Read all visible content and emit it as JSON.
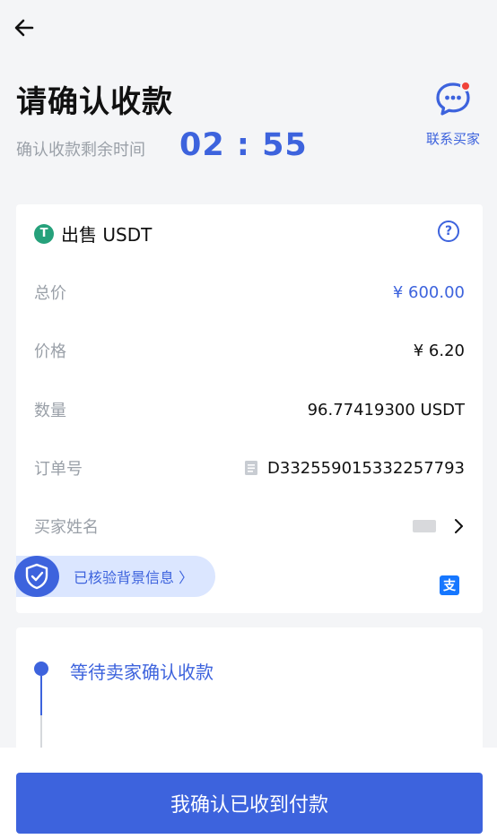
{
  "header": {
    "title": "请确认收款",
    "timer_label": "确认收款剩余时间",
    "timer": "02 : 55",
    "contact_label": "联系买家"
  },
  "order": {
    "title": "出售 USDT",
    "rows": [
      {
        "label": "总价",
        "value": "¥ 600.00"
      },
      {
        "label": "价格",
        "value": "¥ 6.20"
      },
      {
        "label": "数量",
        "value": "96.77419300 USDT"
      },
      {
        "label": "订单号",
        "value": "D332559015332257793"
      },
      {
        "label": "买家姓名",
        "value": ""
      }
    ],
    "verified_label": "已核验背景信息 〉",
    "alipay_glyph": "支"
  },
  "status": {
    "step": "等待卖家确认收款"
  },
  "footer": {
    "confirm_label": "我确认已收到付款"
  },
  "colors": {
    "accent": "#3d63dd",
    "usdt": "#26a17b",
    "alipay": "#1677ff"
  }
}
